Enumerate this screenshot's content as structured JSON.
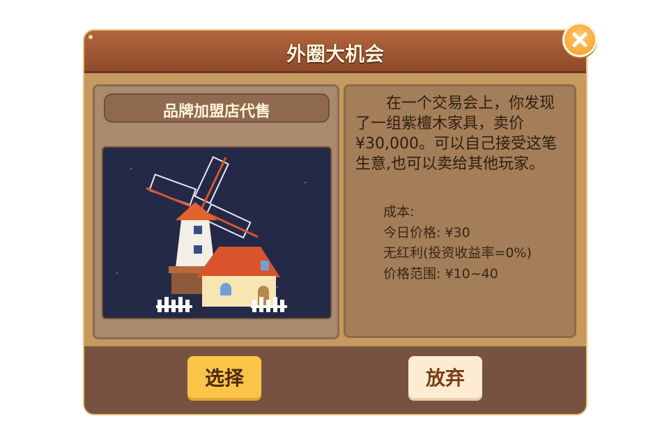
{
  "dialog": {
    "title": "外圈大机会",
    "subtitle": "品牌加盟店代售",
    "description": "在一个交易会上，你发现了一组紫檀木家具，卖价¥30,000。可以自己接受这笔生意,也可以卖给其他玩家。",
    "stats": {
      "cost": "成本:",
      "today_price": "今日价格: ¥30",
      "dividend": "无红利(投资收益率=0%)",
      "price_range": "价格范围: ¥10~40"
    },
    "buttons": {
      "select": "选择",
      "abandon": "放弃"
    }
  },
  "icons": [
    "close-icon",
    "windmill-image"
  ],
  "colors": {
    "title_bar": "#9f5633",
    "select_button": "#fbc54a",
    "abandon_button": "#fdebd3",
    "close_button": "#f5a53a"
  }
}
